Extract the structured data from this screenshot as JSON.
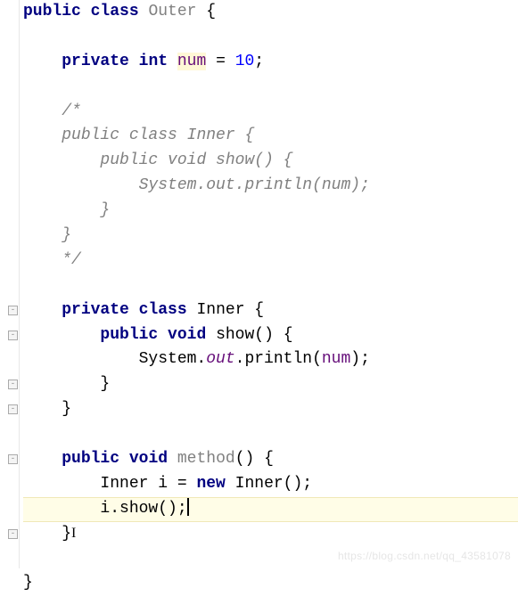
{
  "code": {
    "l1_public": "public",
    "l1_class": "class",
    "l1_name": "Outer",
    "l1_brace": " {",
    "l3_private": "private",
    "l3_int": "int",
    "l3_field": "num",
    "l3_eq": " = ",
    "l3_val": "10",
    "l3_semi": ";",
    "c1": "/*",
    "c2": "public class Inner {",
    "c3": "    public void show() {",
    "c4": "        System.out.println(num);",
    "c5": "    }",
    "c6": "}",
    "c7": "*/",
    "l13_private": "private",
    "l13_class": "class",
    "l13_name": "Inner",
    "l13_brace": " {",
    "l14_public": "public",
    "l14_void": "void",
    "l14_name": "show",
    "l14_paren": "() {",
    "l15_sys": "System.",
    "l15_out": "out",
    "l15_println": ".println(",
    "l15_arg": "num",
    "l15_close": ");",
    "l16": "        }",
    "l17": "    }",
    "l19_public": "public",
    "l19_void": "void",
    "l19_name": "method",
    "l19_paren": "() {",
    "l20_type": "Inner",
    "l20_var": " i = ",
    "l20_new": "new",
    "l20_ctor": " Inner();",
    "l21": "        i.show();",
    "l22": "    }",
    "l24": "}"
  },
  "watermark": "https://blog.csdn.net/qq_43581078"
}
